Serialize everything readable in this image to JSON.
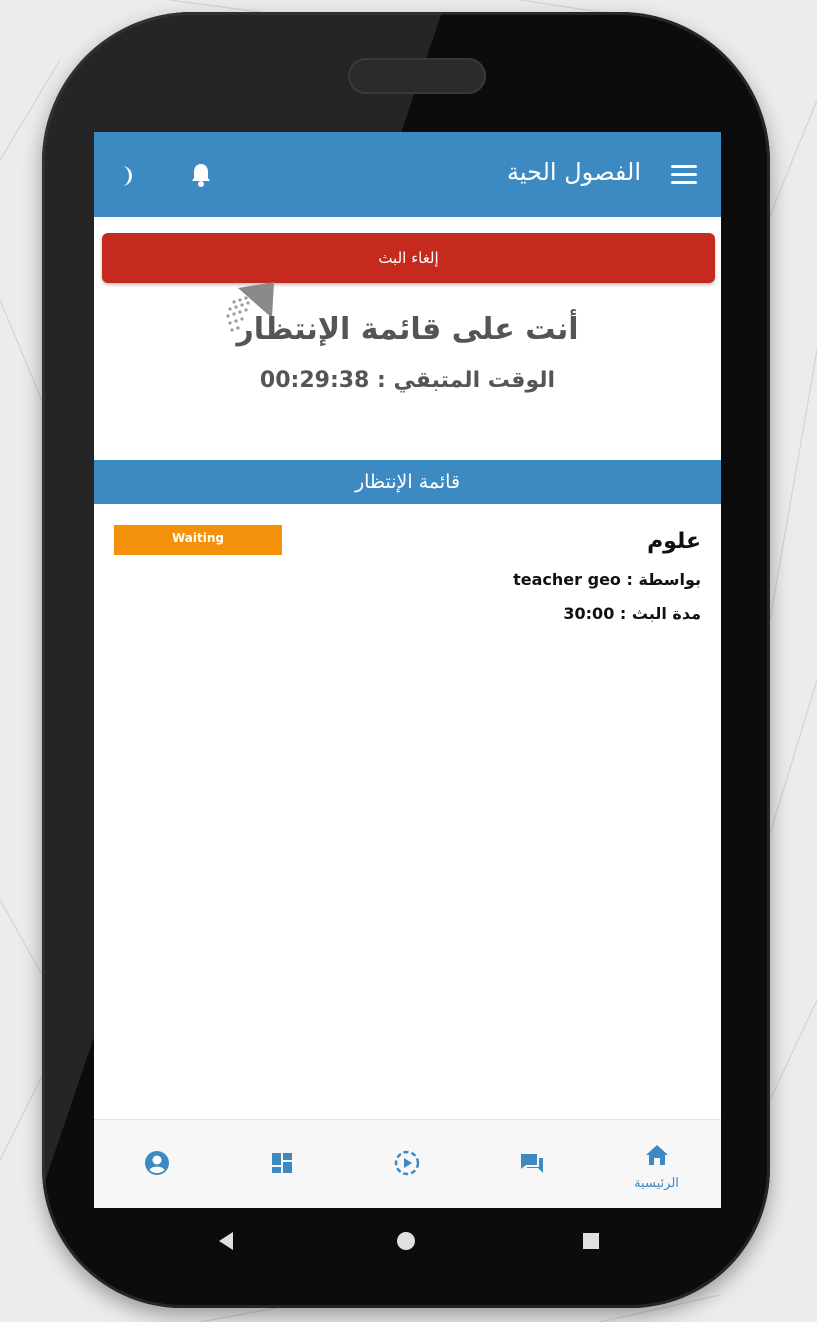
{
  "header": {
    "title": "الفصول الحية"
  },
  "actions": {
    "cancel_label": "إلغاء البث"
  },
  "status": {
    "heading": "أنت على قائمة الإنتظار",
    "remaining_label": "الوقت المتبقي :",
    "remaining_time": "00:29:38"
  },
  "queue": {
    "section_title": "قائمة الإنتظار",
    "items": [
      {
        "subject": "علوم",
        "by_label": "بواسطة :",
        "teacher": "teacher geo",
        "duration_label": "مدة البث :",
        "duration": "30:00",
        "status": "Waiting"
      }
    ]
  },
  "bottom_nav": {
    "home_label": "الرئيسية"
  },
  "colors": {
    "primary": "#3d8ac2",
    "danger": "#c62a1f",
    "waiting": "#f3920a"
  },
  "icons": [
    "menu-icon",
    "bell-icon",
    "moon-icon",
    "loader-icon",
    "profile-icon",
    "dashboard-icon",
    "video-play-icon",
    "chat-icon",
    "home-icon",
    "back-icon",
    "home-circle-icon",
    "recents-icon"
  ]
}
